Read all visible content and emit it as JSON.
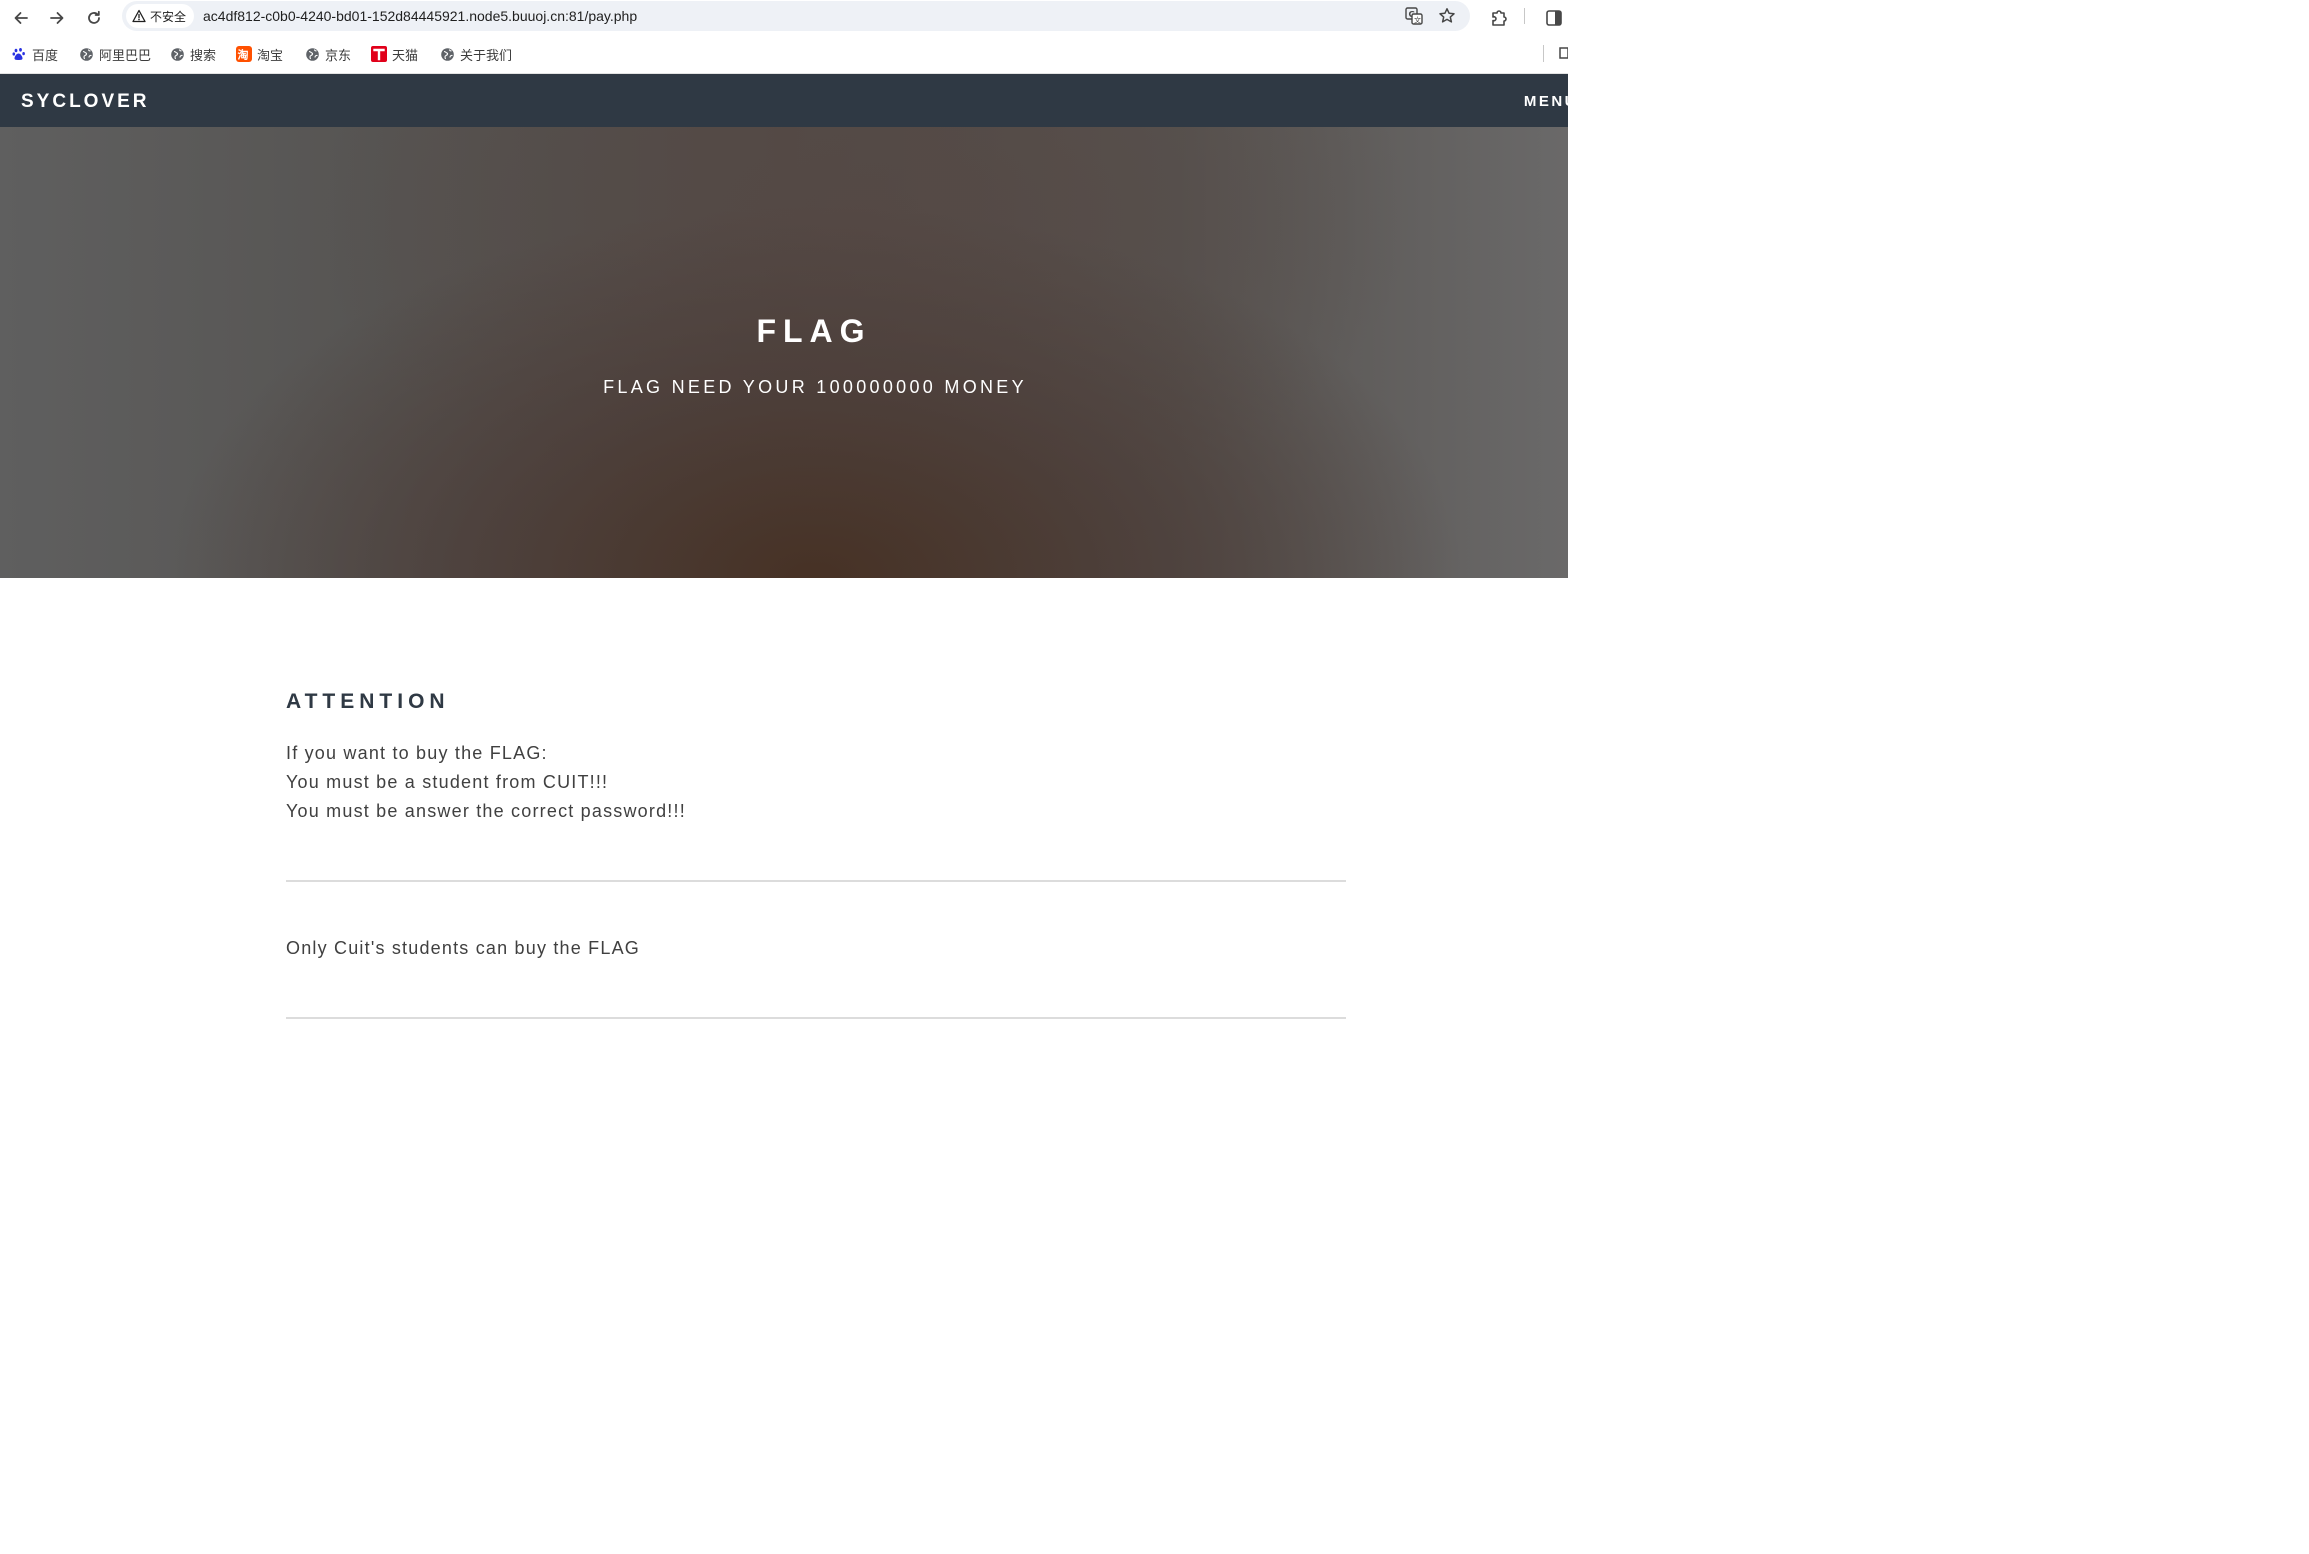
{
  "browser": {
    "security_label": "不安全",
    "url": "ac4df812-c0b0-4240-bd01-152d84445921.node5.buuoj.cn:81/pay.php",
    "icons": {
      "back": "arrow-left-icon",
      "forward": "arrow-right-icon",
      "reload": "reload-icon",
      "security": "warning-triangle-icon",
      "translate": "translate-icon",
      "bookmark": "star-icon",
      "extensions": "puzzle-icon",
      "side_panel": "side-panel-icon"
    }
  },
  "bookmarks": [
    {
      "label": "百度",
      "icon": "baidu-paw-icon"
    },
    {
      "label": "阿里巴巴",
      "icon": "globe-icon"
    },
    {
      "label": "搜索",
      "icon": "globe-icon"
    },
    {
      "label": "淘宝",
      "icon": "taobao-icon"
    },
    {
      "label": "京东",
      "icon": "globe-icon"
    },
    {
      "label": "天猫",
      "icon": "tmall-icon"
    },
    {
      "label": "关于我们",
      "icon": "globe-icon"
    }
  ],
  "navbar": {
    "brand": "SYCLOVER",
    "menu": "MENU"
  },
  "hero": {
    "title": "FLAG",
    "subtitle": "FLAG NEED YOUR 100000000 MONEY"
  },
  "content": {
    "heading": "ATTENTION",
    "lines": [
      "If you want to buy the FLAG:",
      "You must be a student from CUIT!!!",
      "You must be answer the correct password!!!"
    ],
    "notice": "Only Cuit's students can buy the FLAG"
  },
  "colors": {
    "navbar_bg": "#2f3944",
    "heading": "#2f3944",
    "body_text": "#404040",
    "omnibox_bg": "#eef1f6"
  }
}
